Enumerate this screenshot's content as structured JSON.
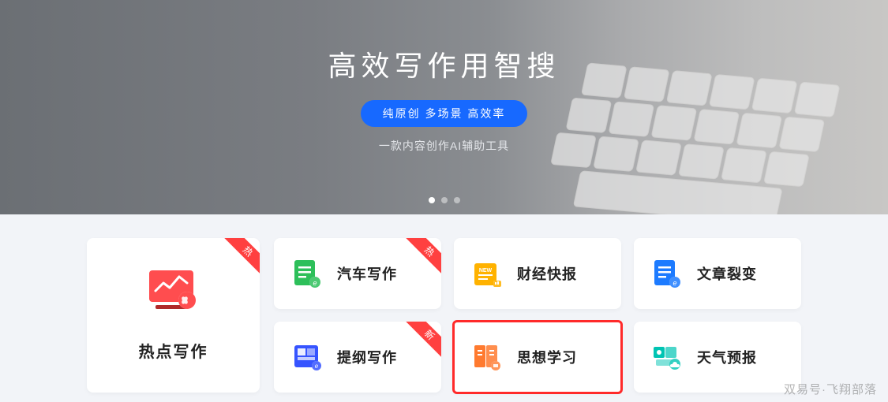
{
  "hero": {
    "title": "高效写作用智搜",
    "pill": "纯原创 多场景 高效率",
    "subtitle": "一款内容创作AI辅助工具"
  },
  "featured": {
    "ribbon": "热",
    "title": "热点写作",
    "color": "#ff4d4f"
  },
  "cards": [
    {
      "title": "汽车写作",
      "ribbon": "热",
      "color": "#2dbf5a",
      "icon": "doc"
    },
    {
      "title": "财经快报",
      "ribbon": "",
      "color": "#ffb200",
      "icon": "news"
    },
    {
      "title": "文章裂变",
      "ribbon": "",
      "color": "#1d7bff",
      "icon": "doc"
    },
    {
      "title": "提纲写作",
      "ribbon": "新",
      "color": "#3654ff",
      "icon": "grid"
    },
    {
      "title": "思想学习",
      "ribbon": "",
      "color": "#ff7a2f",
      "icon": "book",
      "highlighted": true
    },
    {
      "title": "天气预报",
      "ribbon": "",
      "color": "#00c4b3",
      "icon": "weather"
    }
  ],
  "watermark": "双易号·飞翔部落"
}
